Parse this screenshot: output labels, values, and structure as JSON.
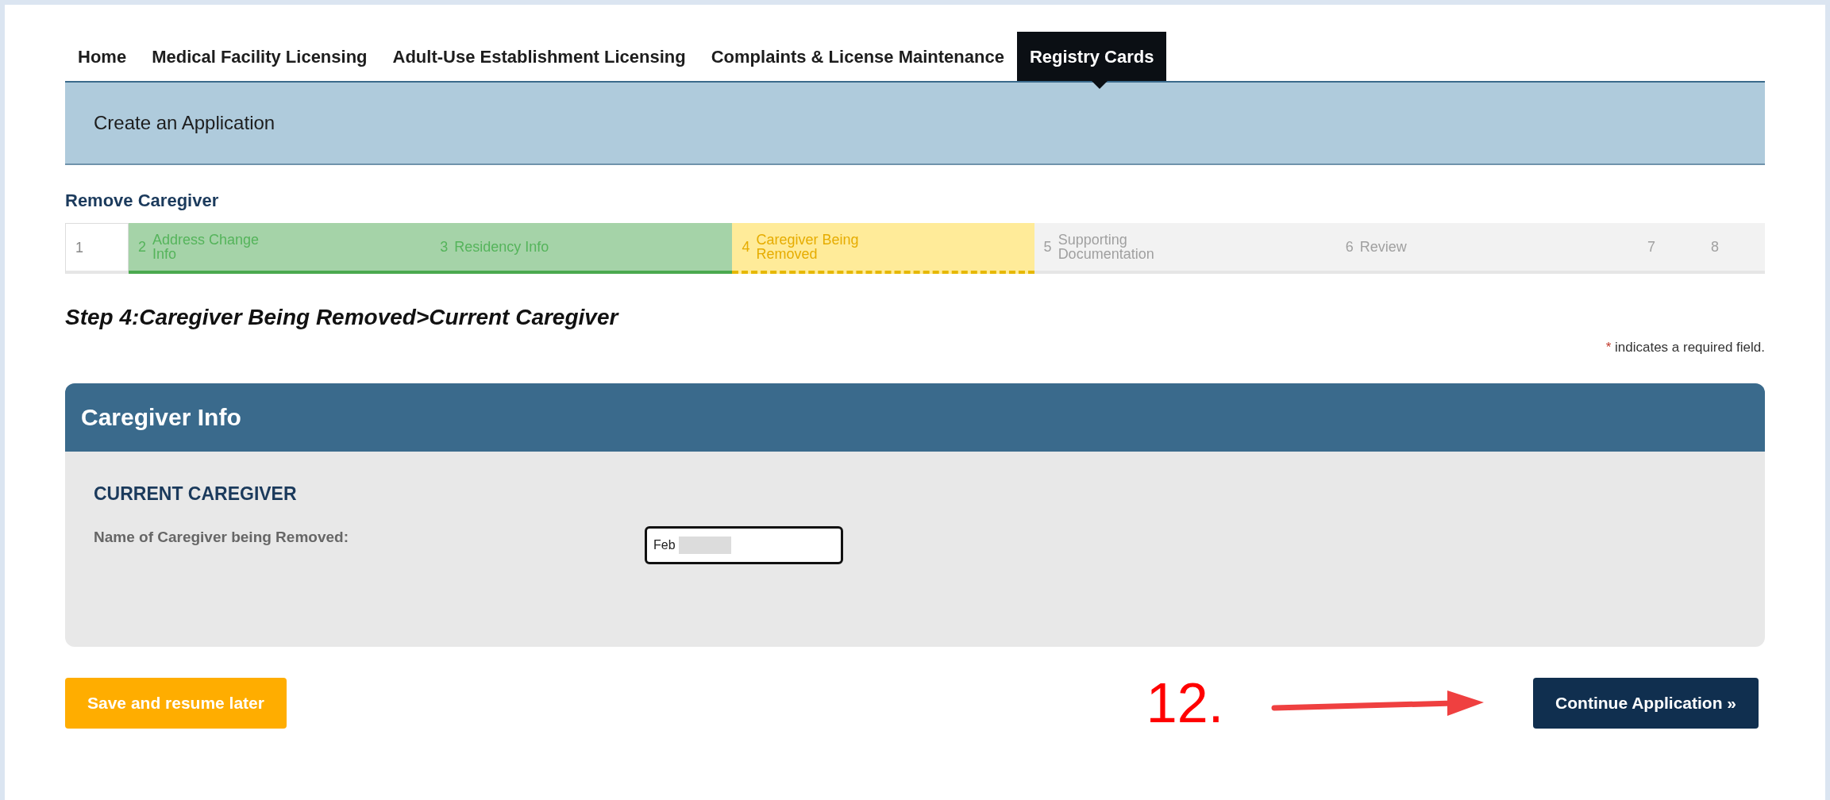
{
  "nav_tabs": [
    {
      "label": "Home",
      "selected": false
    },
    {
      "label": "Medical Facility Licensing",
      "selected": false
    },
    {
      "label": "Adult-Use Establishment Licensing",
      "selected": false
    },
    {
      "label": "Complaints & License Maintenance",
      "selected": false
    },
    {
      "label": "Registry Cards",
      "selected": true
    }
  ],
  "page_header": "Create an Application",
  "process_title": "Remove Caregiver",
  "steps": [
    {
      "number": "1",
      "kind": "inactive"
    },
    {
      "number": "2",
      "label": "Address Change Info",
      "kind": "done"
    },
    {
      "number": "3",
      "label": "Residency Info",
      "kind": "done"
    },
    {
      "number": "4",
      "label": "Caregiver Being Removed",
      "kind": "current"
    },
    {
      "number": "5",
      "label": "Supporting Documentation",
      "kind": "todo"
    },
    {
      "number": "6",
      "label": "Review",
      "kind": "todo"
    },
    {
      "number": "7",
      "kind": "todo"
    },
    {
      "number": "8",
      "kind": "todo"
    }
  ],
  "step_heading": "Step 4:Caregiver Being Removed>Current Caregiver",
  "required_note": {
    "mark": "*",
    "text": "indicates a required field."
  },
  "panel": {
    "title": "Caregiver Info",
    "section": "CURRENT CAREGIVER",
    "fields": [
      {
        "label": "Name of Caregiver being Removed:",
        "value": "Feb",
        "redacted": true
      }
    ]
  },
  "buttons": {
    "save": "Save and resume later",
    "continue": "Continue Application »"
  },
  "annotation": {
    "number": "12."
  }
}
